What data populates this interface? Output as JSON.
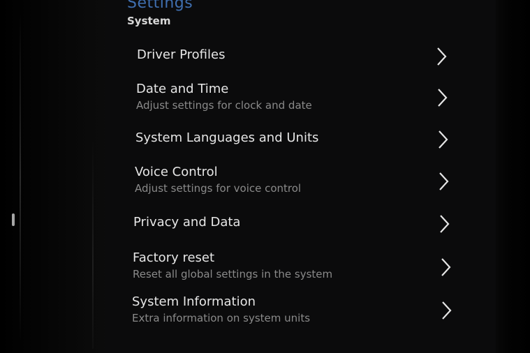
{
  "header": {
    "title": "Settings",
    "subtitle": "System"
  },
  "items": [
    {
      "label": "Driver Profiles",
      "sub": ""
    },
    {
      "label": "Date and Time",
      "sub": "Adjust settings for clock and date"
    },
    {
      "label": "System Languages and Units",
      "sub": ""
    },
    {
      "label": "Voice Control",
      "sub": "Adjust settings for voice control"
    },
    {
      "label": "Privacy and Data",
      "sub": ""
    },
    {
      "label": "Factory reset",
      "sub": "Reset all global settings in the system"
    },
    {
      "label": "System Information",
      "sub": "Extra information on system units"
    }
  ],
  "colors": {
    "accent": "#3f6fb0",
    "text": "#e6e6e6",
    "subtext": "#8a8a8a"
  },
  "icons": {
    "chevron": "chevron-right-icon"
  }
}
